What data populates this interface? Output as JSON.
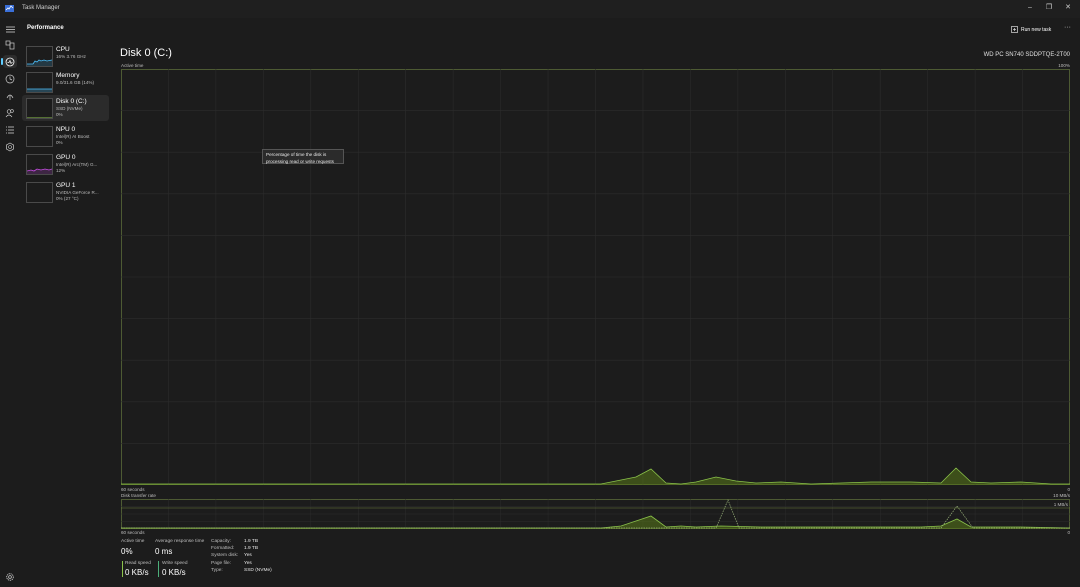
{
  "window": {
    "title": "Task Manager"
  },
  "header": {
    "section_title": "Performance",
    "run_new_task": "Run new task",
    "more": "···"
  },
  "nav": {
    "icons": [
      "processes-icon",
      "performance-icon",
      "app-history-icon",
      "startup-apps-icon",
      "users-icon",
      "details-icon",
      "services-icon"
    ],
    "active": "performance-icon"
  },
  "sidebar": {
    "items": [
      {
        "name": "CPU",
        "sub1": "16%  3.76 GHz",
        "sub2": "",
        "color": "#4cc2ff"
      },
      {
        "name": "Memory",
        "sub1": "9.0/31.6 GB (14%)",
        "sub2": "",
        "color": "#4cc2ff"
      },
      {
        "name": "Disk 0 (C:)",
        "sub1": "SSD (NVMe)",
        "sub2": "0%",
        "color": "#8bc34a"
      },
      {
        "name": "NPU 0",
        "sub1": "Intel(R) AI Boost",
        "sub2": "0%",
        "color": "#4cc2ff"
      },
      {
        "name": "GPU 0",
        "sub1": "Intel(R) Arc(TM) G...",
        "sub2": "12%",
        "color": "#c94ee6"
      },
      {
        "name": "GPU 1",
        "sub1": "NVIDIA GeForce R...",
        "sub2": "0%  (27 °C)",
        "color": "#c94ee6"
      }
    ],
    "selected": "Disk 0 (C:)"
  },
  "main": {
    "title": "Disk 0 (C:)",
    "model": "WD PC SN740 SDDPTQE-2T00",
    "active_time_label": "Active time",
    "active_time_max": "100%",
    "time_left": "60 seconds",
    "time_right": "0",
    "transfer_label": "Disk transfer rate",
    "transfer_max": "10 MB/s",
    "transfer_mid": "1 MB/s",
    "tooltip_line1": "Percentage of time the disk is",
    "tooltip_line2": "processing read or write requests"
  },
  "stats": {
    "active_time_label": "Active time",
    "active_time_value": "0%",
    "response_label": "Average response time",
    "response_value": "0 ms",
    "read_label": "Read speed",
    "read_value": "0 KB/s",
    "write_label": "Write speed",
    "write_value": "0 KB/s"
  },
  "properties": [
    {
      "label": "Capacity:",
      "value": "1.9 TB"
    },
    {
      "label": "Formatted:",
      "value": "1.9 TB"
    },
    {
      "label": "System disk:",
      "value": "Yes"
    },
    {
      "label": "Page file:",
      "value": "Yes"
    },
    {
      "label": "Type:",
      "value": "SSD (NVMe)"
    }
  ],
  "colors": {
    "disk_accent": "#8bc34a",
    "write_accent": "#4caf7a",
    "accent": "#60cdff"
  }
}
